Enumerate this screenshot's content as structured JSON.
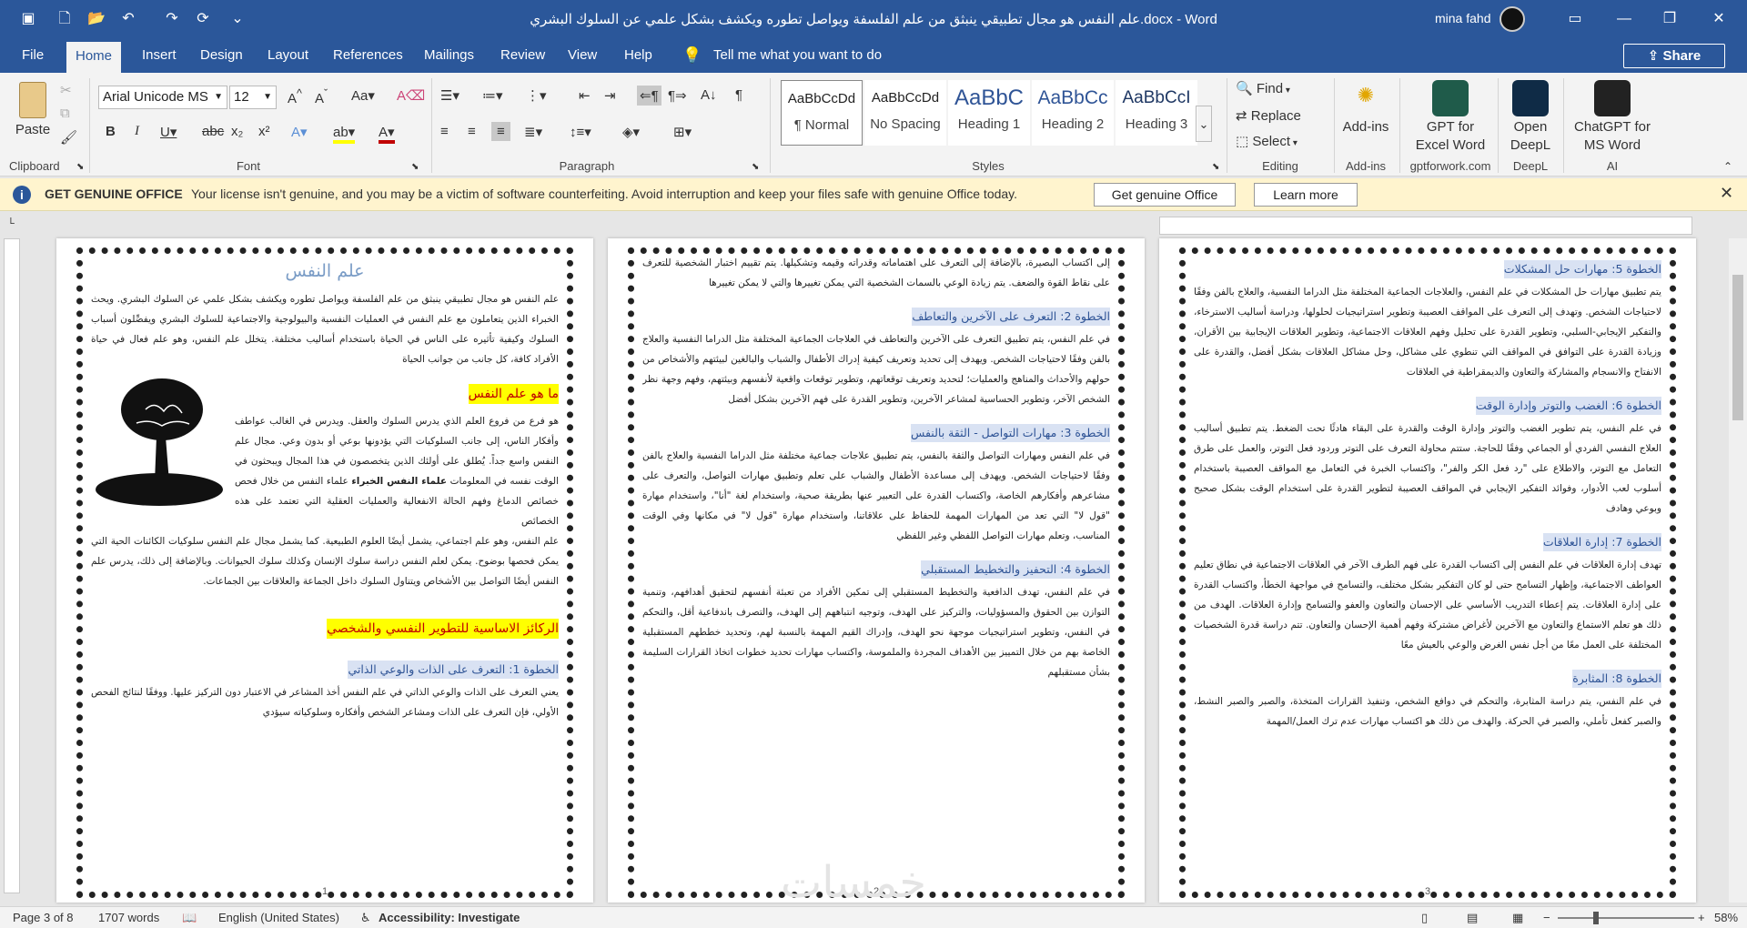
{
  "window": {
    "title": "علم النفس هو مجال تطبيقي ينبثق من علم الفلسفة ويواصل تطوره ويكشف بشكل علمي عن السلوك البشري.docx  -  Word",
    "user_name": "mina fahd",
    "accent": "#2b579a"
  },
  "quick_access": [
    "autosave-icon",
    "new-icon",
    "open-icon",
    "undo-icon",
    "redo-icon",
    "save-form-icon",
    "customize-icon"
  ],
  "tabs": {
    "file": "File",
    "home": "Home",
    "insert": "Insert",
    "design": "Design",
    "layout": "Layout",
    "references": "References",
    "mailings": "Mailings",
    "review": "Review",
    "view": "View",
    "help": "Help"
  },
  "tell_me": "Tell me what you want to do",
  "share": "Share",
  "ribbon": {
    "clipboard": {
      "label": "Clipboard",
      "paste": "Paste"
    },
    "font": {
      "label": "Font",
      "font_name": "Arial Unicode MS",
      "font_size": "12"
    },
    "paragraph": {
      "label": "Paragraph"
    },
    "styles": {
      "label": "Styles",
      "items": [
        {
          "preview": "AaBbCcDd",
          "name": "¶ Normal"
        },
        {
          "preview": "AaBbCcDd",
          "name": "No Spacing"
        },
        {
          "preview": "AaBbC",
          "name": "Heading 1"
        },
        {
          "preview": "AaBbCc",
          "name": "Heading 2"
        },
        {
          "preview": "AaBbCcI",
          "name": "Heading 3"
        }
      ]
    },
    "editing": {
      "label": "Editing",
      "find": "Find",
      "replace": "Replace",
      "select": "Select"
    },
    "addins": {
      "label": "Add-ins",
      "button": "Add-ins"
    },
    "gpt_excel": {
      "label": "gptforwork.com",
      "line1": "GPT for",
      "line2": "Excel Word"
    },
    "deepl": {
      "label": "DeepL",
      "line1": "Open",
      "line2": "DeepL"
    },
    "ai": {
      "label": "AI",
      "line1": "ChatGPT for",
      "line2": "MS Word"
    }
  },
  "infobar": {
    "title": "GET GENUINE OFFICE",
    "message": "Your license isn't genuine, and you may be a victim of software counterfeiting. Avoid interruption and keep your files safe with genuine Office today.",
    "button1": "Get genuine Office",
    "button2": "Learn more"
  },
  "pages": [
    {
      "title": "علم النفس",
      "p1": "علم النفس هو مجال تطبيقي ينبثق من علم الفلسفة ويواصل تطوره ويكشف بشكل علمي عن السلوك البشري. ويحث الخبراء الذين يتعاملون مع علم النفس في العمليات النفسية والبيولوجية والاجتماعية للسلوك البشري ويفصِّلون أسباب السلوك وكيفية تأثيره على الناس في الحياة باستخدام أساليب مختلفة. يتخلل علم النفس، وهو علم فعال في حياة الأفراد كافة، كل جانب من جوانب الحياة",
      "h1": "ما هو علم النفس",
      "p2": "هو فرع من فروع العلم الذي يدرس السلوك والعقل. ويدرس في الغالب عواطف وأفكار الناس، إلى جانب السلوكيات التي يؤدونها بوعي أو بدون وعي. مجال علم النفس واسع جداً. يُطلق على أولئك الذين يتخصصون في هذا المجال ويبحثون في الوقت نفسه في المعلومات",
      "p2_bold": "علماء النفس الخبراء",
      "p2b": "علماء النفس من خلال فحص خصائص الدماغ وفهم الحالة الانفعالية والعمليات العقلية التي تعتمد على هذه الخصائص",
      "p3": "علم النفس، وهو علم اجتماعي، يشمل أيضًا العلوم الطبيعية. كما يشمل مجال علم النفس سلوكيات الكائنات الحية التي يمكن فحصها بوضوح. يمكن لعلم النفس دراسة سلوك الإنسان وكذلك سلوك الحيوانات. وبالإضافة إلى ذلك، يدرس علم النفس أيضًا التواصل بين الأشخاص ويتناول السلوك داخل الجماعة والعلاقات بين الجماعات.",
      "h2": "الركائز الاساسية للتطوير النفسي والشخصي",
      "h3": "الخطوة 1: التعرف على الذات والوعي الذاتي",
      "p4": "يعني التعرف على الذات والوعي الذاتي في علم النفس أخذ المشاعر في الاعتبار دون التركيز عليها. ووفقًا لنتائج الفحص الأولي، فإن التعرف على الذات ومشاعر الشخص وأفكاره وسلوكياته سيؤدي",
      "num": "1"
    },
    {
      "p0": "إلى اكتساب البصيرة، بالإضافة إلى التعرف على اهتماماته وقدراته وقيمه وتشكيلها. يتم تقييم اختبار الشخصية للتعرف على نقاط القوة والضعف. يتم زيادة الوعي بالسمات الشخصية التي يمكن تغييرها والتي لا يمكن تغييرها",
      "h1": "الخطوة 2: التعرف على الآخرين والتعاطف",
      "p1": "في علم النفس، يتم تطبيق التعرف على الآخرين والتعاطف في العلاجات الجماعية المختلفة مثل الدراما النفسية والعلاج بالفن وفقًا لاحتياجات الشخص. ويهدف إلى تحديد وتعريف كيفية إدراك الأطفال والشباب والبالغين لبيئتهم والأشخاص من حولهم والأحداث والمناهج والعمليات؛ لتحديد وتعريف توقعاتهم، وتطوير توقعات واقعية لأنفسهم وبيئتهم، وفهم وجهة نظر الشخص الآخر، وتطوير الحساسية لمشاعر الآخرين، وتطوير القدرة على فهم الآخرين بشكل أفضل",
      "h2": "الخطوة 3: مهارات التواصل - الثقة بالنفس",
      "p2": "في علم النفس ومهارات التواصل والثقة بالنفس، يتم تطبيق علاجات جماعية مختلفة مثل الدراما النفسية والعلاج بالفن وفقًا لاحتياجات الشخص. ويهدف إلى مساعدة الأطفال والشباب على تعلم وتطبيق مهارات التواصل، والتعرف على مشاعرهم وأفكارهم الخاصة، واكتساب القدرة على التعبير عنها بطريقة صحية، واستخدام لغة \"أنا\"، واستخدام مهارة \"قول لا\" التي تعد من المهارات المهمة للحفاظ على علاقاتنا، واستخدام مهارة \"قول لا\" في مكانها وفي الوقت المناسب، وتعلم مهارات التواصل اللفظي وغير اللفظي",
      "h3": "الخطوة 4: التحفيز والتخطيط المستقبلي",
      "p3": "في علم النفس، تهدف الدافعية والتخطيط المستقبلي إلى تمكين الأفراد من تعبئة أنفسهم لتحقيق أهدافهم، وتنمية التوازن بين الحقوق والمسؤوليات، والتركيز على الهدف، وتوجيه انتباههم إلى الهدف، والتصرف باندفاعية أقل، والتحكم في النفس، وتطوير استراتيجيات موجهة نحو الهدف، وإدراك القيم المهمة بالنسبة لهم، وتحديد خططهم المستقبلية الخاصة بهم من خلال التمييز بين الأهداف المجردة والملموسة، واكتساب مهارات تحديد خطوات اتخاذ القرارات السليمة بشأن مستقبلهم",
      "num": "2"
    },
    {
      "h1": "الخطوة 5: مهارات حل المشكلات",
      "p1": "يتم تطبيق مهارات حل المشكلات في علم النفس، والعلاجات الجماعية المختلفة مثل الدراما النفسية، والعلاج بالفن وفقًا لاحتياجات الشخص. وتهدف إلى التعرف على المواقف العصيبة وتطوير استراتيجيات لحلولها، ودراسة أساليب الاسترخاء، والتفكير الإيجابي-السلبي، وتطوير القدرة على تحليل وفهم العلاقات الاجتماعية، وتطوير العلاقات الإيجابية بين الأقران، وزيادة القدرة على التوافق في المواقف التي تنطوي على مشاكل، وحل مشاكل العلاقات بشكل أفضل، والقدرة على الانفتاح والانسجام والمشاركة والتعاون والديمقراطية في العلاقات",
      "h2": "الخطوة 6: الغضب والتوتر وإدارة الوقت",
      "p2": "في علم النفس، يتم تطوير الغضب والتوتر وإدارة الوقت والقدرة على البقاء هادئًا تحت الضغط. يتم تطبيق أساليب العلاج النفسي الفردي أو الجماعي وفقًا للحاجة. ستتم محاولة التعرف على التوتر وردود فعل التوتر، والعمل على طرق التعامل مع التوتر، والاطلاع على \"رد فعل الكر والفر\"، واكتساب الخبرة في التعامل مع المواقف العصيبة باستخدام أسلوب لعب الأدوار، وفوائد التفكير الإيجابي في المواقف العصيبة لتطوير القدرة على استخدام الوقت بشكل صحيح وبوعي وهادف",
      "h3": "الخطوة 7: إدارة العلاقات",
      "p3": "تهدف إدارة العلاقات في علم النفس إلى اكتساب القدرة على فهم الطرف الآخر في العلاقات الاجتماعية في نطاق تعليم العواطف الاجتماعية، وإظهار التسامح حتى لو كان التفكير بشكل مختلف، والتسامح في مواجهة الخطأ، واكتساب القدرة على إدارة العلاقات. يتم إعطاء التدريب الأساسي على الإحسان والتعاون والعفو والتسامح وإدارة العلاقات. الهدف من ذلك هو تعلم الاستماع والتعاون مع الآخرين لأغراض مشتركة وفهم أهمية الإحسان والتعاون. تتم دراسة قدرة الشخصيات المختلفة على العمل معًا من أجل نفس الغرض والوعي بالعيش معًا",
      "h4": "الخطوة 8: المثابرة",
      "p4": "في علم النفس، يتم دراسة المثابرة، والتحكم في دوافع الشخص، وتنفيذ القرارات المتخذة، والصبر والصبر النشط، والصبر كفعل تأملي، والصبر في الحركة. والهدف من ذلك هو اكتساب مهارات عدم ترك العمل/المهمة",
      "num": "3"
    }
  ],
  "watermark": "خمسات",
  "statusbar": {
    "page": "Page 3 of 8",
    "words": "1707 words",
    "language": "English (United States)",
    "accessibility": "Accessibility: Investigate",
    "zoom": "58%"
  }
}
